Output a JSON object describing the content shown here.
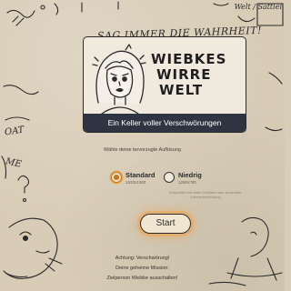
{
  "scribbles": {
    "top_tag": "SAG IMMER DIE WAHRHEIT!",
    "left_tag_1": "OAT",
    "left_tag_2": "ME",
    "right_tag": "Welt / Sattlel"
  },
  "title_card": {
    "logo_line_1": "WIEBKES",
    "logo_line_2": "WIRRE",
    "logo_line_3": "WELT",
    "subtitle": "Ein Keller voller Verschwörungen"
  },
  "resolution": {
    "label": "Wähle deine bevorzugte Auflösung",
    "options": [
      {
        "title": "Standard",
        "sub": "1920x1080",
        "selected": true
      },
      {
        "title": "Niedrig",
        "sub": "1280x780",
        "selected": false
      }
    ],
    "hint": "Empfohlen bei alten Geräten oder schlechter Internetverbindung"
  },
  "start_button": {
    "label": "Start"
  },
  "mission": {
    "line_1": "Achtung: Verschwörung!",
    "line_2": "Deine geheime Mission:",
    "line_3": "Zielperson Wiebke ausschalten!"
  },
  "colors": {
    "background": "#d8ccb6",
    "subtitle_bar": "#2f3442",
    "accent": "#c9761e",
    "glow": "#eca452"
  }
}
